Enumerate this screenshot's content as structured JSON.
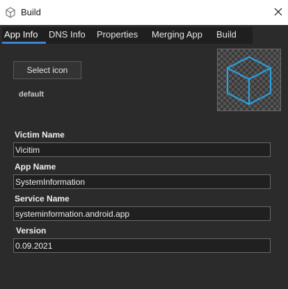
{
  "window": {
    "title": "Build",
    "icon": "cube-icon",
    "close_icon": "close-icon"
  },
  "tabs": [
    {
      "label": "App Info",
      "active": true
    },
    {
      "label": "DNS Info",
      "active": false
    },
    {
      "label": "Properties",
      "active": false
    },
    {
      "label": "Merging App",
      "active": false
    },
    {
      "label": "Build",
      "active": false
    }
  ],
  "icon_section": {
    "select_icon_label": "Select icon",
    "icon_name": "default",
    "preview_icon": "cube-icon"
  },
  "fields": {
    "victim_name": {
      "label": "Victim Name",
      "value": "Vicitim"
    },
    "app_name": {
      "label": "App Name",
      "value": "SystemInformation"
    },
    "service_name": {
      "label": "Service Name",
      "value": "systeminformation.android.app"
    },
    "version": {
      "label": "Version",
      "value": "0.09.2021"
    }
  },
  "colors": {
    "accent": "#3c86d8",
    "background": "#2b2b2b",
    "cube": "#2b9fe0"
  }
}
